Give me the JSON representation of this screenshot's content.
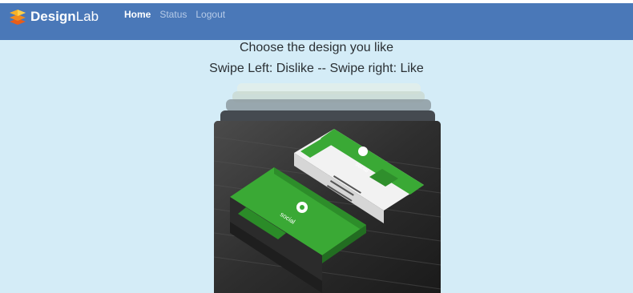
{
  "navbar": {
    "brand": {
      "bold": "Design",
      "light": "Lab",
      "icon": "layers-logo-icon"
    },
    "links": [
      {
        "label": "Home",
        "active": true
      },
      {
        "label": "Status",
        "active": false
      },
      {
        "label": "Logout",
        "active": false
      }
    ],
    "background_color": "#4a78b8"
  },
  "main": {
    "title": "Choose the design you like",
    "instructions": "Swipe Left: Dislike -- Swipe right: Like",
    "background_color": "#d4ecf7"
  },
  "card": {
    "image_description_icon": "business-card-image",
    "accent_color": "#3aa935"
  }
}
